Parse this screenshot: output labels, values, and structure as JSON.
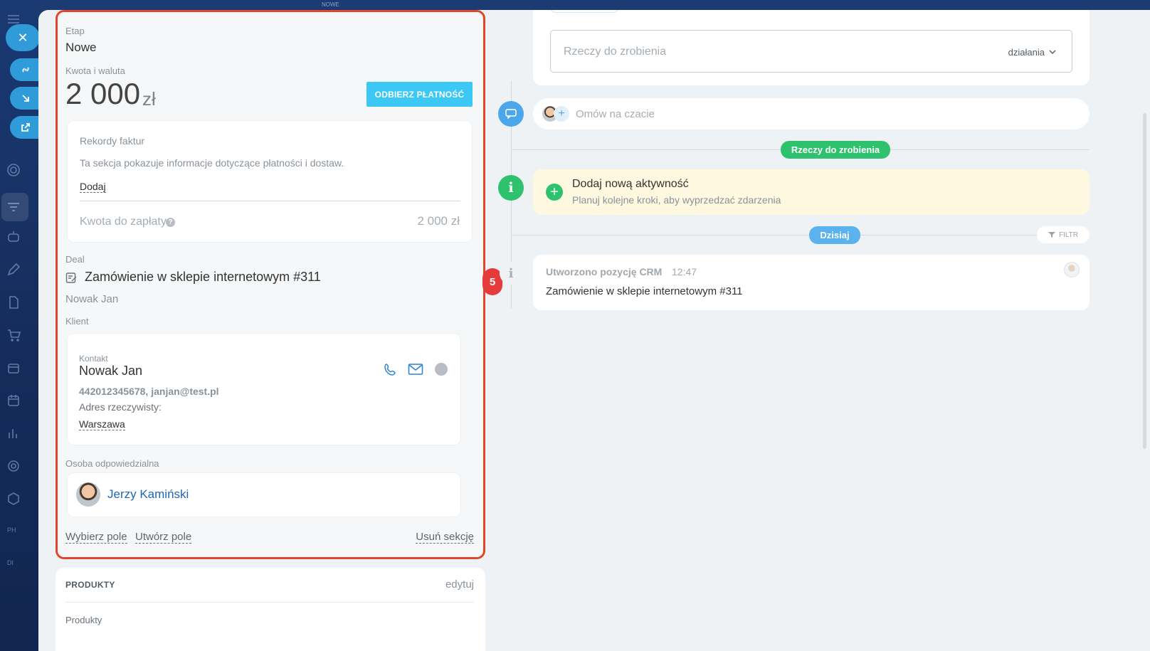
{
  "top": {
    "stage_tab": "NOWE"
  },
  "sidebar": {
    "text_a": "PH",
    "text_b": "DI"
  },
  "stage": {
    "label": "Etap",
    "value": "Nowe"
  },
  "amount": {
    "label": "Kwota i waluta",
    "value": "2 000",
    "currency": "zł",
    "pay_button": "ODBIERZ PŁATNOŚĆ"
  },
  "invoices": {
    "title": "Rekordy faktur",
    "description": "Ta sekcja pokazuje informacje dotyczące płatności i dostaw.",
    "add_link": "Dodaj",
    "due_label": "Kwota do zapłaty",
    "due_value": "2 000 zł"
  },
  "deal": {
    "label": "Deal",
    "title": "Zamówienie w sklepie internetowym #311",
    "owner_name": "Nowak Jan"
  },
  "client": {
    "label": "Klient",
    "contact_label": "Kontakt",
    "name": "Nowak Jan",
    "details": "442012345678, janjan@test.pl",
    "address_label": "Adres rzeczywisty:",
    "city": "Warszawa"
  },
  "responsible": {
    "label": "Osoba odpowiedzialna",
    "name": "Jerzy Kamiński"
  },
  "footer_links": {
    "select_field": "Wybierz pole",
    "create_field": "Utwórz pole",
    "delete_section": "Usuń sekcję"
  },
  "products": {
    "title": "PRODUKTY",
    "edit": "edytuj",
    "sub": "Produkty"
  },
  "right": {
    "todo_placeholder": "Rzeczy do zrobienia",
    "actions_label": "działania",
    "chat_placeholder": "Omów na czacie",
    "todo_badge": "Rzeczy do zrobienia",
    "add_activity_title": "Dodaj nową aktywność",
    "add_activity_sub": "Planuj kolejne kroki, aby wyprzedzać zdarzenia",
    "today_badge": "Dzisiaj",
    "filter_label": "FILTR",
    "event_title": "Utworzono pozycję CRM",
    "event_time": "12:47",
    "event_body": "Zamówienie w sklepie internetowym #311"
  },
  "annotation": {
    "number": "5"
  },
  "colors": {
    "accent": "#3bc8f5",
    "frame": "#e2462a",
    "green": "#2fc26e",
    "blue_badge": "#5ab2ee",
    "marker": "#e63b3b"
  }
}
